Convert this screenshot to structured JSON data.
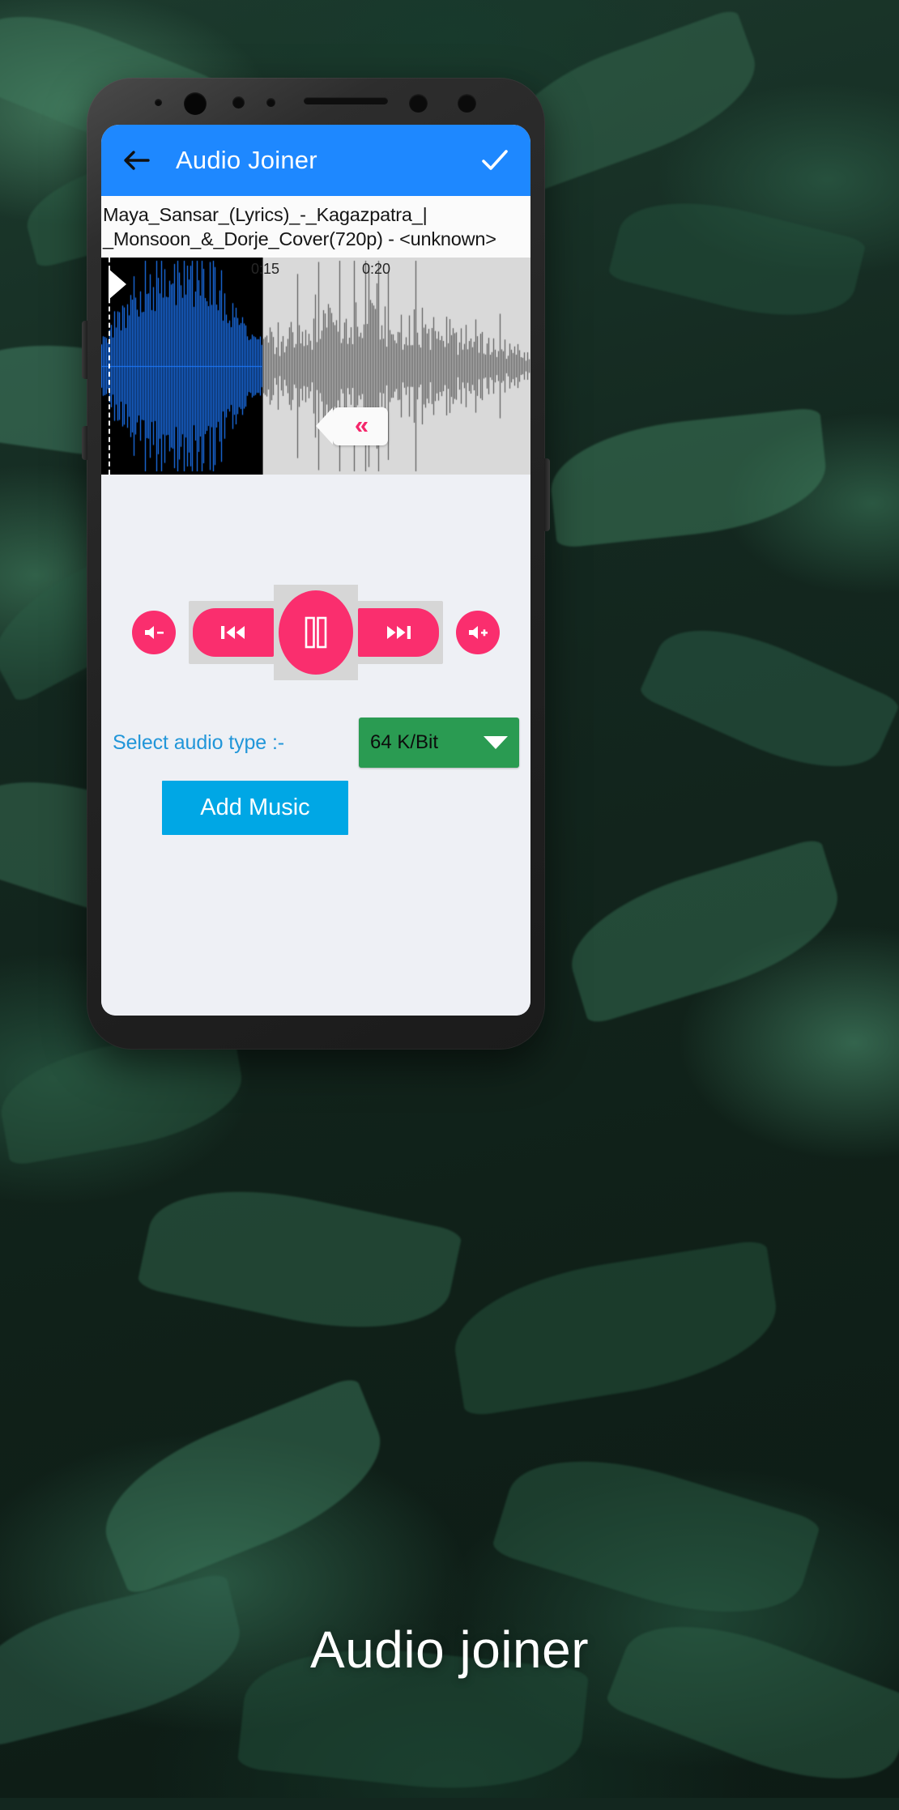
{
  "appbar": {
    "back_icon": "arrow-left-icon",
    "title": "Audio Joiner",
    "confirm_icon": "check-icon"
  },
  "file": {
    "line1": "Maya_Sansar_(Lyrics)_-_Kagazpatra_|",
    "line2": "_Monsoon_&_Dorje_Cover(720p) - <unknown>"
  },
  "waveform": {
    "ruler_labels": [
      "0:15",
      "0:20"
    ],
    "start_marker_icon": "play-marker-icon",
    "trim_handle_icon": "double-chevron-left-icon",
    "selection_color": "#000000",
    "selected_wave_color": "#1e7bff",
    "unselected_wave_color": "#5b5b5b",
    "track_background": "#d9d9d9"
  },
  "controls": {
    "volume_down_icon": "volume-down-icon",
    "previous_icon": "skip-previous-icon",
    "play_pause_icon": "pause-icon",
    "next_icon": "skip-next-icon",
    "volume_up_icon": "volume-up-icon",
    "accent_color": "#fa2e6e"
  },
  "audio_type": {
    "label": "Select audio type :-",
    "selected": "64 K/Bit",
    "caret_icon": "chevron-down-icon",
    "select_color": "#2a9b52",
    "label_color": "#2196d9"
  },
  "actions": {
    "add_music": "Add Music",
    "add_music_color": "#00a7e5"
  },
  "caption": {
    "text": "Audio joiner"
  }
}
